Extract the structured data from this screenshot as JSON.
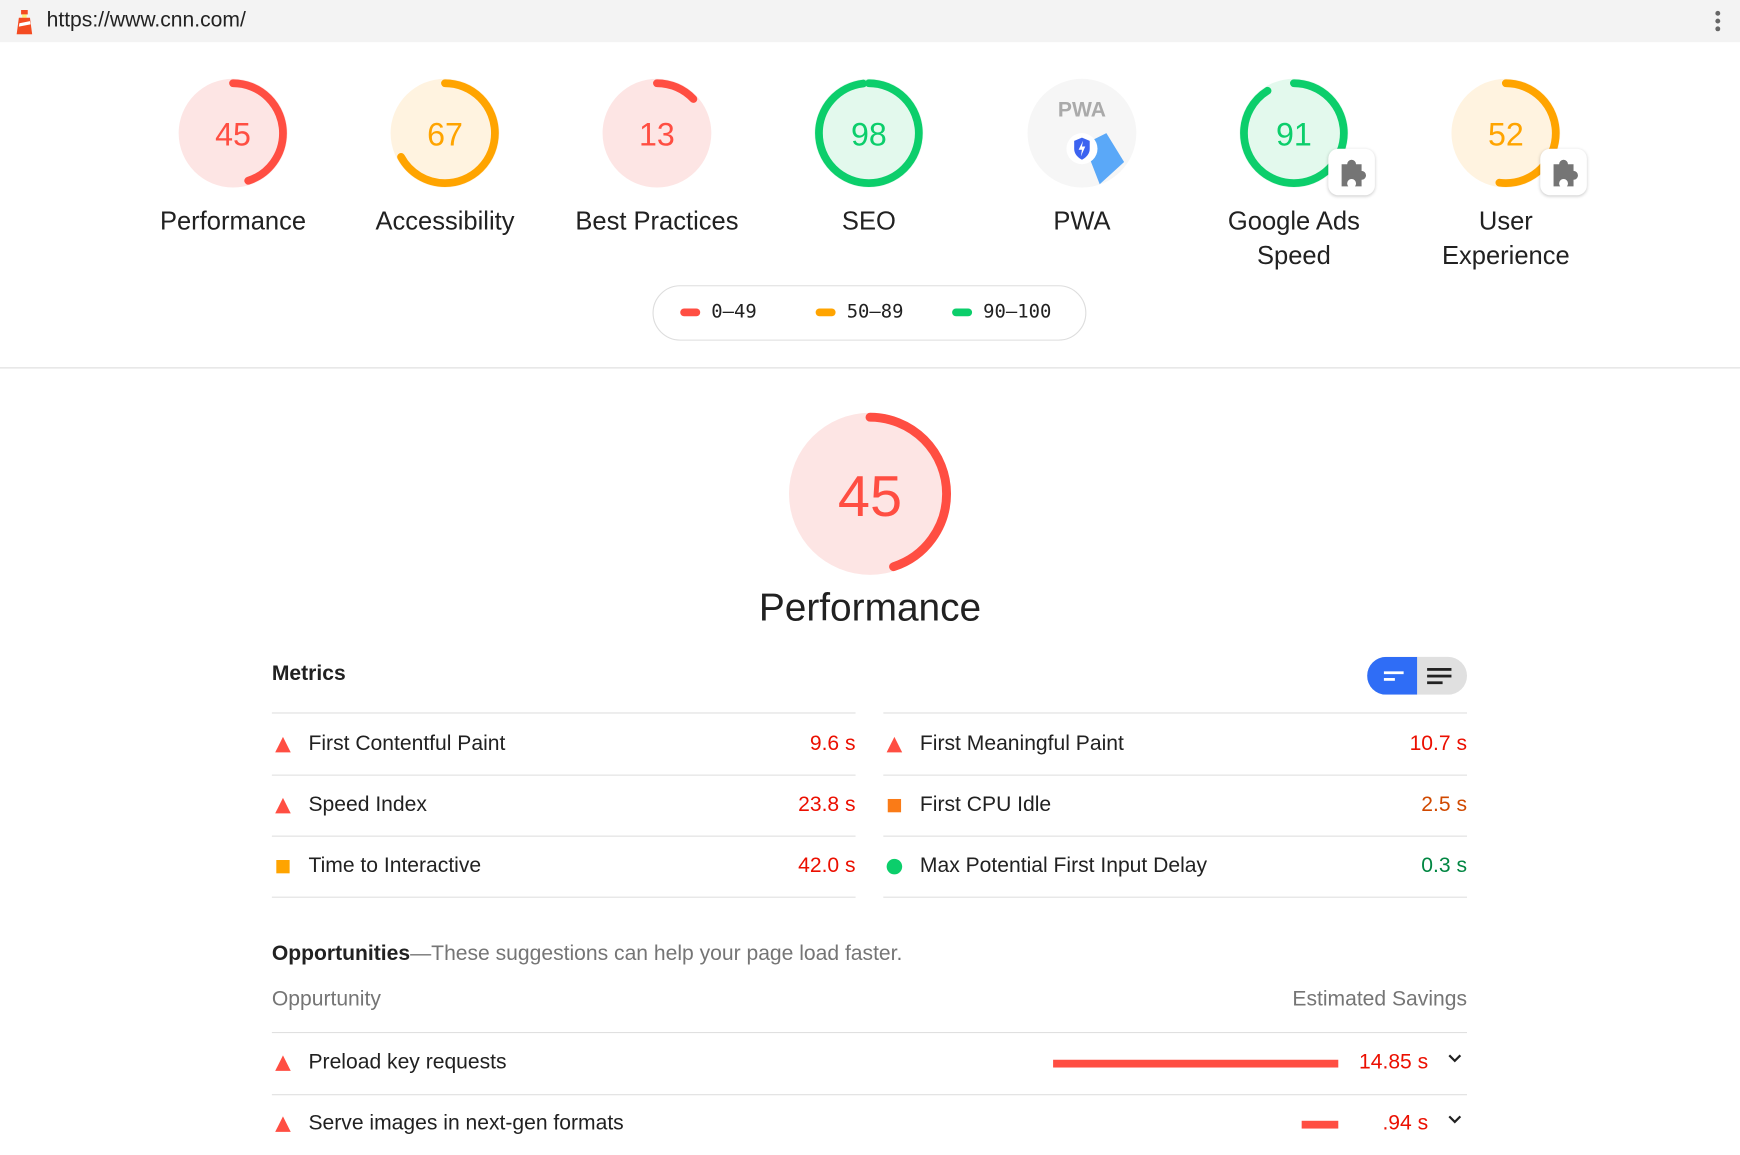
{
  "browser": {
    "url": "https://www.cnn.com/",
    "lighthouse_icon": "lighthouse-icon",
    "menu_icon": "kebab-menu-icon"
  },
  "colors": {
    "fail": "#ff4e42",
    "average": "#ffa400",
    "pass": "#0cce6b",
    "fail_bg": "#fde5e4",
    "average_bg": "#fff3e0",
    "pass_bg": "#e3f9ed",
    "text_fail": "#eb0f00",
    "text_avg": "#d04900",
    "text_pass": "#018642",
    "toggle": "#2f6df6"
  },
  "gauges": [
    {
      "score": 45,
      "label": "Performance",
      "rating": "fail"
    },
    {
      "score": 67,
      "label": "Accessibility",
      "rating": "average"
    },
    {
      "score": 13,
      "label": "Best Practices",
      "rating": "fail"
    },
    {
      "score": 98,
      "label": "SEO",
      "rating": "pass"
    },
    {
      "score": null,
      "label": "PWA",
      "rating": "pwa",
      "badge_text": "PWA"
    },
    {
      "score": 91,
      "label": "Google Ads Speed",
      "rating": "pass",
      "plugin": true
    },
    {
      "score": 52,
      "label": "User Experience",
      "rating": "average",
      "plugin": true
    }
  ],
  "legend": [
    {
      "range": "0–49",
      "rating": "fail"
    },
    {
      "range": "50–89",
      "rating": "average"
    },
    {
      "range": "90–100",
      "rating": "pass"
    }
  ],
  "main": {
    "score": 45,
    "title": "Performance"
  },
  "metrics": {
    "title": "Metrics",
    "items": [
      {
        "label": "First Contentful Paint",
        "value": "9.6 s",
        "rating": "fail"
      },
      {
        "label": "First Meaningful Paint",
        "value": "10.7 s",
        "rating": "fail"
      },
      {
        "label": "Speed Index",
        "value": "23.8 s",
        "rating": "fail"
      },
      {
        "label": "First CPU Idle",
        "value": "2.5 s",
        "rating": "average"
      },
      {
        "label": "Time to Interactive",
        "value": "42.0 s",
        "rating": "average_icon_fail_value"
      },
      {
        "label": "Max Potential First Input Delay",
        "value": "0.3 s",
        "rating": "pass"
      }
    ]
  },
  "opportunities": {
    "title": "Opportunities",
    "subtitle": "—These suggestions can help your page load faster.",
    "col_opportunity": "Oppurtunity",
    "col_savings": "Estimated Savings",
    "items": [
      {
        "label": "Preload key requests",
        "savings": "14.85 s",
        "savings_seconds": 14.85
      },
      {
        "label": "Serve images in next-gen formats",
        "savings": ".94 s",
        "savings_seconds": 0.94
      }
    ]
  }
}
